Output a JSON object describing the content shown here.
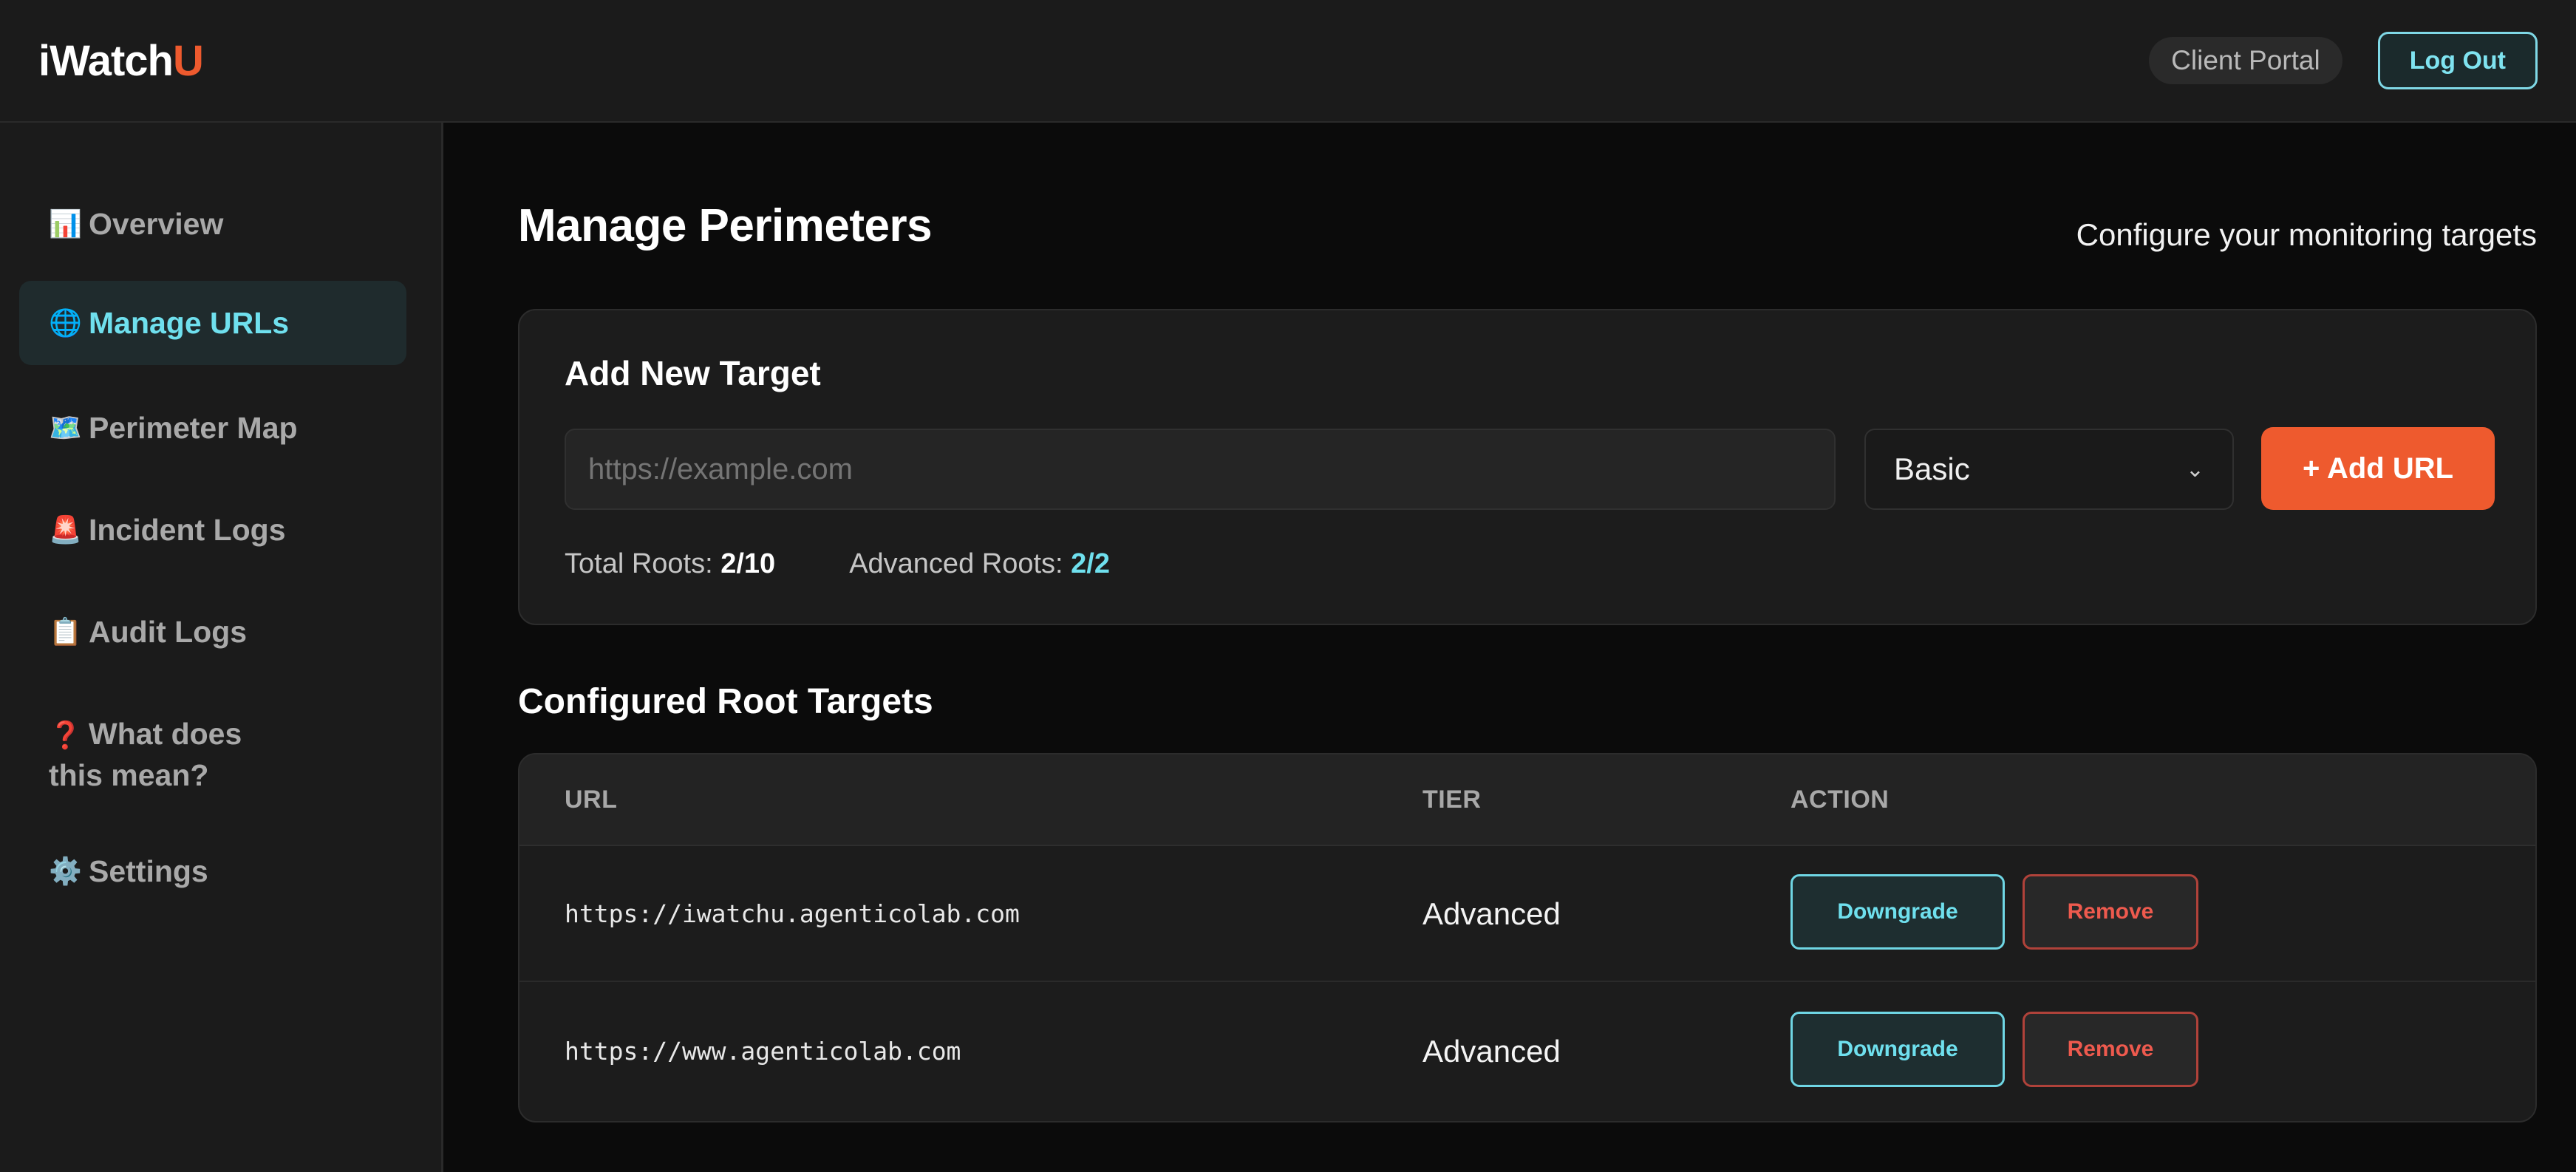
{
  "header": {
    "brand_main": "iWatch",
    "brand_accent": "U",
    "portal_label": "Client Portal",
    "logout_label": "Log Out"
  },
  "sidebar": {
    "items": [
      {
        "icon": "📊",
        "icon_name": "bar-chart-icon",
        "label": "Overview",
        "active": false
      },
      {
        "icon": "🌐",
        "icon_name": "globe-icon",
        "label": "Manage URLs",
        "active": true
      },
      {
        "icon": "🗺️",
        "icon_name": "map-icon",
        "label": "Perimeter Map",
        "active": false
      },
      {
        "icon": "🚨",
        "icon_name": "siren-icon",
        "label": "Incident Logs",
        "active": false
      },
      {
        "icon": "📋",
        "icon_name": "clipboard-icon",
        "label": "Audit Logs",
        "active": false
      },
      {
        "icon": "❓",
        "icon_name": "question-icon",
        "label": "What does this mean?",
        "active": false
      },
      {
        "icon": "⚙️",
        "icon_name": "gear-icon",
        "label": "Settings",
        "active": false
      }
    ]
  },
  "main": {
    "title": "Manage Perimeters",
    "subtitle": "Configure your monitoring targets",
    "add_card": {
      "title": "Add New Target",
      "url_placeholder": "https://example.com",
      "url_value": "",
      "tier_selected": "Basic",
      "add_label": "+ Add URL",
      "total_roots_label": "Total Roots:",
      "total_roots_value": "2/10",
      "advanced_roots_label": "Advanced Roots:",
      "advanced_roots_value": "2/2"
    },
    "targets": {
      "title": "Configured Root Targets",
      "columns": [
        "URL",
        "TIER",
        "ACTION"
      ],
      "rows": [
        {
          "url": "https://iwatchu.agenticolab.com",
          "tier": "Advanced",
          "downgrade": "Downgrade",
          "remove": "Remove"
        },
        {
          "url": "https://www.agenticolab.com",
          "tier": "Advanced",
          "downgrade": "Downgrade",
          "remove": "Remove"
        }
      ]
    }
  },
  "colors": {
    "accent_orange": "#ee5a2e",
    "accent_cyan": "#6fe0ee",
    "danger_red": "#ee5a4e",
    "background": "#0b0b0b",
    "panel": "#1b1b1b"
  }
}
